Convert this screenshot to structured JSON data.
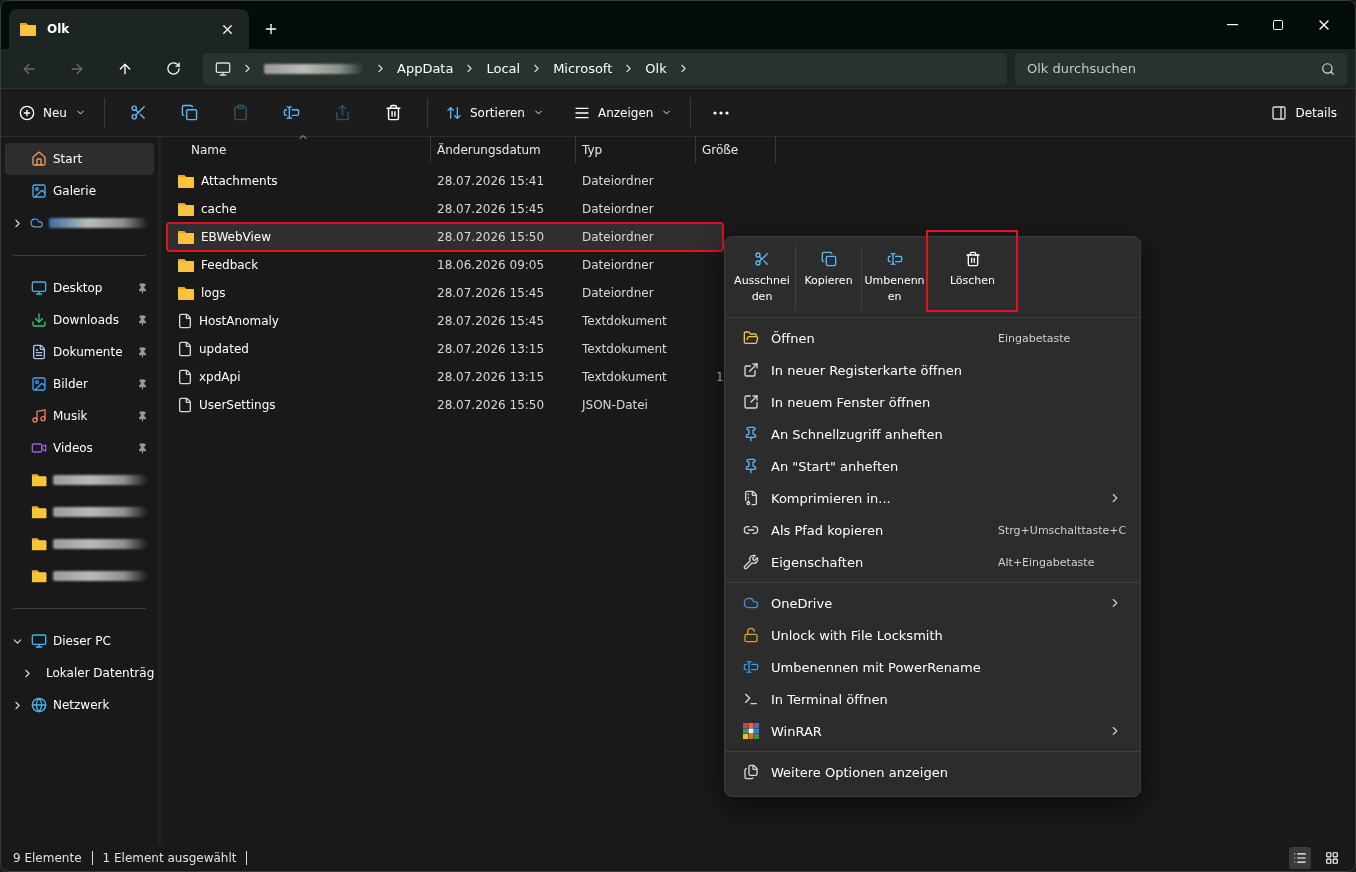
{
  "window": {
    "tab_title": "Olk"
  },
  "navigation": {
    "breadcrumb": [
      {
        "kind": "redacted"
      },
      {
        "kind": "text",
        "label": "AppData"
      },
      {
        "kind": "text",
        "label": "Local"
      },
      {
        "kind": "text",
        "label": "Microsoft"
      },
      {
        "kind": "text",
        "label": "Olk"
      }
    ],
    "search": {
      "placeholder": "Olk durchsuchen"
    }
  },
  "toolbar": {
    "new_label": "Neu",
    "tools": [
      {
        "kind": "cut",
        "disabled": false
      },
      {
        "kind": "copy",
        "disabled": false
      },
      {
        "kind": "paste",
        "disabled": true
      },
      {
        "kind": "rename",
        "disabled": false
      },
      {
        "kind": "share",
        "disabled": true
      },
      {
        "kind": "delete",
        "disabled": false
      }
    ],
    "sort_label": "Sortieren",
    "view_label": "Anzeigen",
    "details_label": "Details"
  },
  "sidebar": {
    "groups": [
      [
        {
          "kind": "item",
          "label": "Start",
          "selected": true,
          "pinned": false
        },
        {
          "kind": "item",
          "label": "Galerie",
          "selected": false,
          "pinned": false
        },
        {
          "kind": "redacted",
          "selected": false,
          "pinned": false
        }
      ],
      [
        {
          "kind": "item",
          "label": "Desktop",
          "selected": false,
          "pinned": true
        },
        {
          "kind": "item",
          "label": "Downloads",
          "selected": false,
          "pinned": true
        },
        {
          "kind": "item",
          "label": "Dokumente",
          "selected": false,
          "pinned": true
        },
        {
          "kind": "item",
          "label": "Bilder",
          "selected": false,
          "pinned": true
        },
        {
          "kind": "item",
          "label": "Musik",
          "selected": false,
          "pinned": true
        },
        {
          "kind": "item",
          "label": "Videos",
          "selected": false,
          "pinned": true
        },
        {
          "kind": "redacted",
          "selected": false,
          "pinned": false
        },
        {
          "kind": "redacted",
          "selected": false,
          "pinned": false
        },
        {
          "kind": "redacted",
          "selected": false,
          "pinned": false
        },
        {
          "kind": "redacted",
          "selected": false,
          "pinned": false
        }
      ]
    ],
    "tree": [
      {
        "label": "Dieser PC",
        "expanded": true,
        "children": [
          {
            "label": "Lokaler Datenträg",
            "expanded": false
          }
        ]
      },
      {
        "label": "Netzwerk",
        "expanded": false
      }
    ]
  },
  "table": {
    "columns": [
      {
        "label": "Name",
        "sorted": true
      },
      {
        "label": "Änderungsdatum",
        "sorted": false
      },
      {
        "label": "Typ",
        "sorted": false
      },
      {
        "label": "Größe",
        "sorted": false
      }
    ],
    "rows": [
      {
        "kind": "folder",
        "name": "Attachments",
        "date": "28.07.2026 15:41",
        "type": "Dateiordner",
        "selected": false,
        "highlighted": false
      },
      {
        "kind": "folder",
        "name": "cache",
        "date": "28.07.2026 15:45",
        "type": "Dateiordner",
        "selected": false,
        "highlighted": false
      },
      {
        "kind": "folder",
        "name": "EBWebView",
        "date": "28.07.2026 15:50",
        "type": "Dateiordner",
        "selected": true,
        "highlighted": true
      },
      {
        "kind": "folder",
        "name": "Feedback",
        "date": "18.06.2026 09:05",
        "type": "Dateiordner",
        "selected": false,
        "highlighted": false
      },
      {
        "kind": "folder",
        "name": "logs",
        "date": "28.07.2026 15:45",
        "type": "Dateiordner",
        "selected": false,
        "highlighted": false
      },
      {
        "kind": "file",
        "name": "HostAnomaly",
        "date": "28.07.2026 15:45",
        "type": "Textdokument",
        "selected": false,
        "highlighted": false
      },
      {
        "kind": "file",
        "name": "updated",
        "date": "28.07.2026 13:15",
        "type": "Textdokument",
        "selected": false,
        "highlighted": false
      },
      {
        "kind": "file",
        "name": "xpdApi",
        "date": "28.07.2026 13:15",
        "type": "Textdokument",
        "size": "1",
        "selected": false,
        "highlighted": false
      },
      {
        "kind": "file",
        "name": "UserSettings",
        "date": "28.07.2026 15:50",
        "type": "JSON-Datei",
        "selected": false,
        "highlighted": false
      }
    ]
  },
  "context_menu": {
    "actions": [
      {
        "kind": "cut",
        "label": "Ausschneiden",
        "highlighted": false
      },
      {
        "kind": "copy",
        "label": "Kopieren",
        "highlighted": false
      },
      {
        "kind": "rename",
        "label": "Umbenennen",
        "highlighted": false
      },
      {
        "kind": "delete",
        "label": "Löschen",
        "highlighted": true
      }
    ],
    "groups": [
      [
        {
          "label": "Öffnen",
          "shortcut": "Eingabetaste",
          "submenu": false
        },
        {
          "label": "In neuer Registerkarte öffnen",
          "submenu": false
        },
        {
          "label": "In neuem Fenster öffnen",
          "submenu": false
        },
        {
          "label": "An Schnellzugriff anheften",
          "submenu": false
        },
        {
          "label": "An \"Start\" anheften",
          "submenu": false
        },
        {
          "label": "Komprimieren in...",
          "submenu": true
        },
        {
          "label": "Als Pfad kopieren",
          "shortcut": "Strg+Umschalttaste+C",
          "submenu": false
        },
        {
          "label": "Eigenschaften",
          "shortcut": "Alt+Eingabetaste",
          "submenu": false
        }
      ],
      [
        {
          "label": "OneDrive",
          "submenu": true
        },
        {
          "label": "Unlock with File Locksmith",
          "submenu": false
        },
        {
          "label": "Umbenennen mit PowerRename",
          "submenu": false
        },
        {
          "label": "In Terminal öffnen",
          "submenu": false
        },
        {
          "label": "WinRAR",
          "submenu": true
        }
      ],
      [
        {
          "label": "Weitere Optionen anzeigen",
          "submenu": false
        }
      ]
    ]
  },
  "status_bar": {
    "count": "9 Elemente",
    "selection": "1 Element ausgewählt"
  }
}
